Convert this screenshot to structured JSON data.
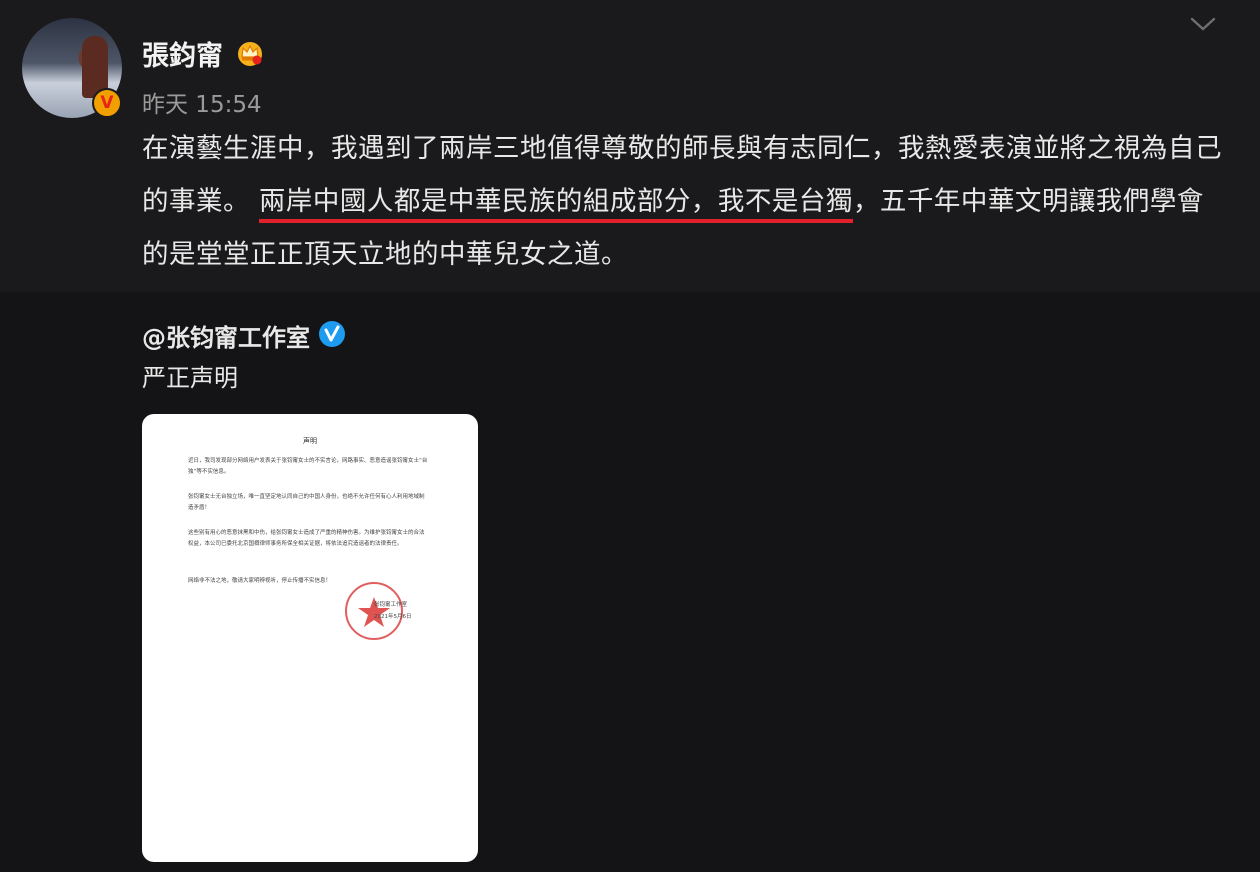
{
  "post": {
    "author": "張鈞甯",
    "time": "昨天 15:54",
    "verified_badge": "V",
    "text_before": "在演藝生涯中，我遇到了兩岸三地值得尊敬的師長與有志同仁，我熱愛表演並將之視為自己的事業。 ",
    "text_highlight": "兩岸中國人都是中華民族的組成部分，我不是台獨",
    "text_after": "，五千年中華文明讓我們學會的是堂堂正正頂天立地的中華兒女之道。",
    "highlight_color": "#e0202a",
    "icons": [
      "crown-icon",
      "chevron-down-icon",
      "verified-v-badge-icon"
    ]
  },
  "repost": {
    "author": "@张钧甯工作室",
    "text": "严正声明",
    "icons": [
      "blue-verified-icon"
    ],
    "document": {
      "title": "声明",
      "paragraphs": [
        "近日，我司发现部分网络用户发表关于张钧甯女士的不实言论，网路事实、恶意造谣张钧甯女士“台独”等不实信息。",
        "张钧甯女士无台独立场，唯一直坚定地认同自己的中国人身份，也绝不允许任何有心人利用地域制造矛盾！",
        "这些别有用心的恶意抹黑和中伤，给张钧甯女士造成了严重的精神伤害。为维护张钧甯女士的合法权益，本公司已委托北京国樽律师事务所保全相关证据，将依法追究造谣者的法律责任。",
        "网络非不法之地，敬请大家明辨视听，停止传播不实信息！"
      ],
      "signature": "张钧甯工作室",
      "date": "2021年5月6日"
    }
  },
  "colors": {
    "background": "#141416",
    "post_background": "#1a1a1c",
    "text": "#e8e8e8",
    "muted": "#9a9a9a",
    "badge_orange": "#f2a000",
    "badge_red": "#e8231b",
    "blue_verified": "#1d9bf0"
  }
}
